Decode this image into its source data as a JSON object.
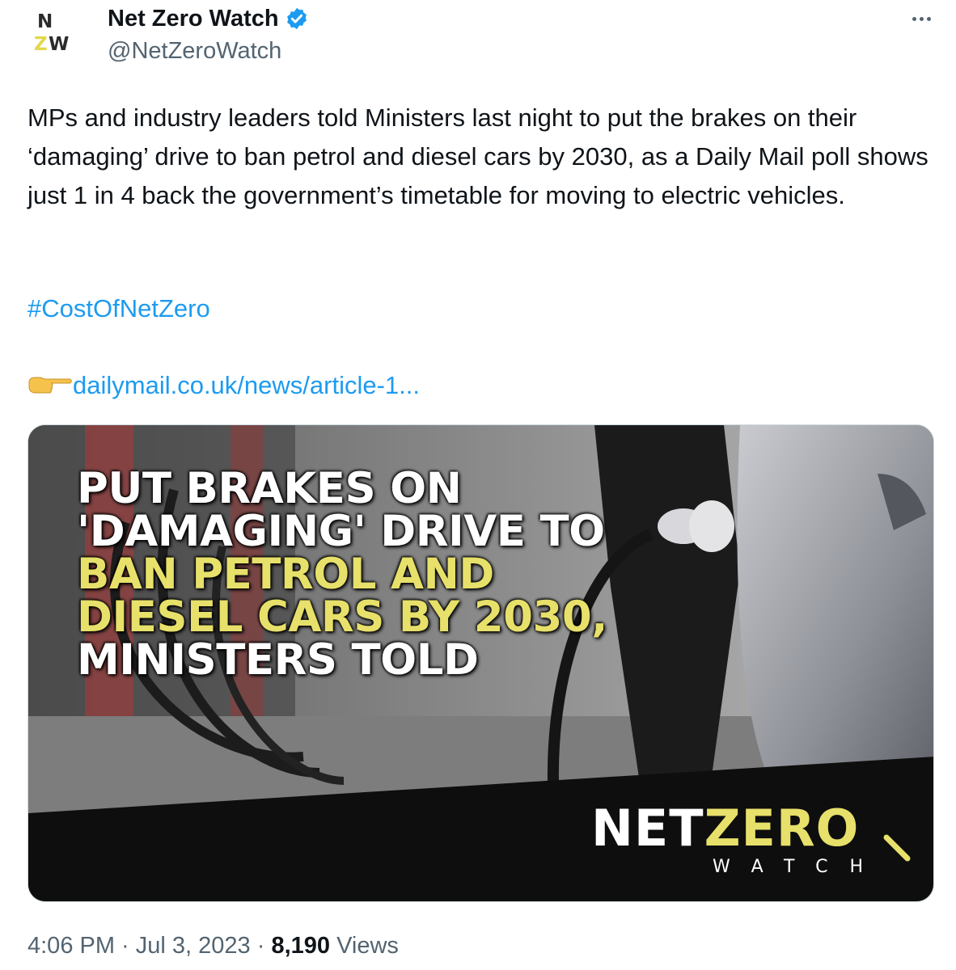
{
  "account": {
    "avatar_letters": [
      "N",
      "Z",
      "W"
    ],
    "display_name": "Net Zero Watch",
    "handle": "@NetZeroWatch"
  },
  "tweet": {
    "text": "MPs and industry leaders told Ministers last night to put the brakes on their ‘damaging’ drive to ban petrol and diesel cars by 2030, as a Daily Mail poll shows just 1 in 4 back the government’s timetable for moving to electric vehicles.",
    "hashtag": "#CostOfNetZero",
    "link_text": "dailymail.co.uk/news/article-1..."
  },
  "image": {
    "headline_white_1": "PUT BRAKES ON 'DAMAGING' DRIVE TO ",
    "headline_yellow": "BAN PETROL AND DIESEL CARS BY 2030,",
    "headline_white_2": " MINISTERS TOLD",
    "brand_net": "NET",
    "brand_zero": "ZERO",
    "brand_watch": "WATCH"
  },
  "footer": {
    "time": "4:06 PM",
    "sep1": " · ",
    "date": "Jul 3, 2023",
    "sep2": " · ",
    "views_count": "8,190",
    "views_label": " Views"
  },
  "colors": {
    "accent_blue": "#1d9bf0",
    "brand_yellow": "#e7e06a",
    "muted": "#536471"
  },
  "icons": [
    "verified-badge-icon",
    "more-options-icon",
    "pointing-hand-icon",
    "magnifier-icon"
  ]
}
